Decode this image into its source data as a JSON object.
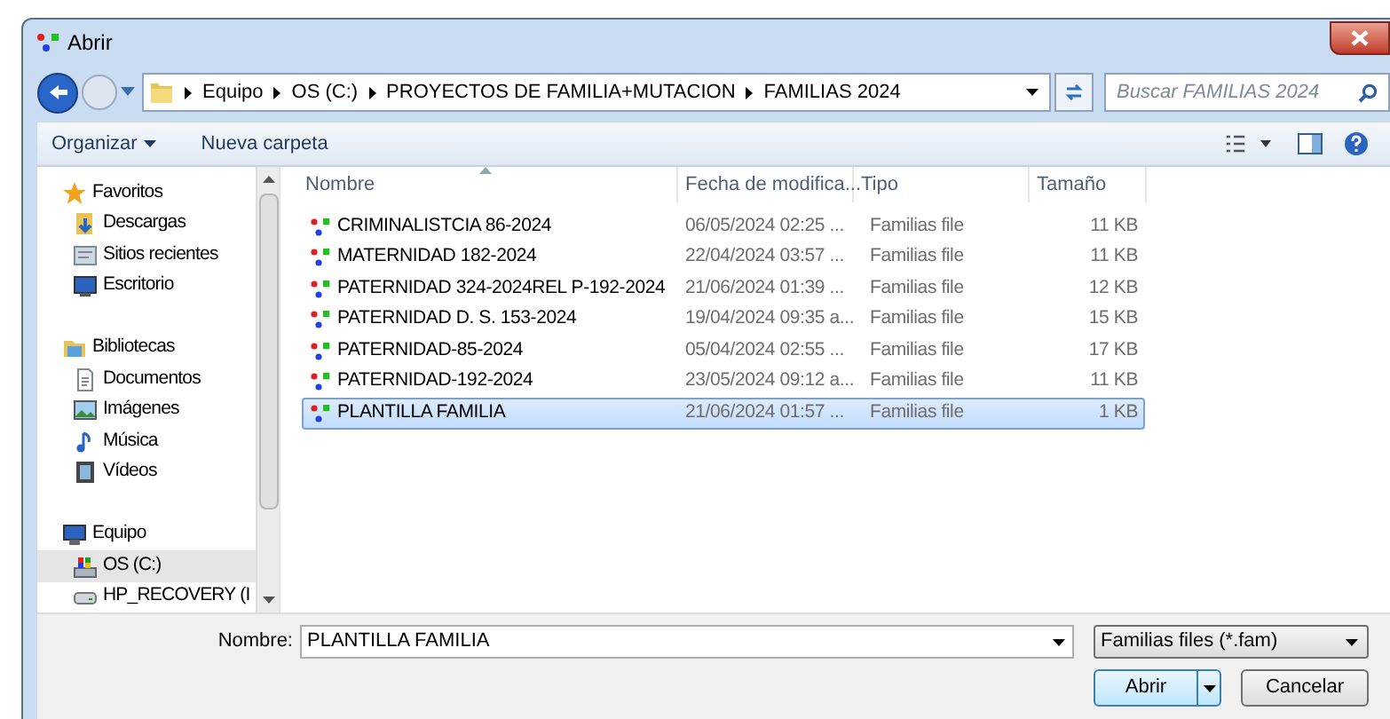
{
  "window": {
    "title": "Abrir"
  },
  "breadcrumb": [
    "Equipo",
    "OS (C:)",
    "PROYECTOS DE FAMILIA+MUTACION",
    "FAMILIAS 2024"
  ],
  "search": {
    "placeholder": "Buscar FAMILIAS 2024"
  },
  "toolbar": [
    "Organizar",
    "Nueva carpeta"
  ],
  "sidebar": [
    {
      "label": "Favoritos",
      "kind": "star",
      "selected": false,
      "children": [
        {
          "label": "Descargas",
          "kind": "download",
          "selected": false
        },
        {
          "label": "Sitios recientes",
          "kind": "recent",
          "selected": false
        },
        {
          "label": "Escritorio",
          "kind": "desktop",
          "selected": false
        }
      ]
    },
    {
      "label": "Bibliotecas",
      "kind": "library",
      "selected": false,
      "children": [
        {
          "label": "Documentos",
          "kind": "document",
          "selected": false
        },
        {
          "label": "Imágenes",
          "kind": "image",
          "selected": false
        },
        {
          "label": "Música",
          "kind": "music",
          "selected": false
        },
        {
          "label": "Vídeos",
          "kind": "video",
          "selected": false
        }
      ]
    },
    {
      "label": "Equipo",
      "kind": "computer",
      "selected": false,
      "children": [
        {
          "label": "OS (C:)",
          "kind": "drive",
          "selected": true
        },
        {
          "label": "HP_RECOVERY (I",
          "kind": "hdd",
          "selected": false
        }
      ]
    }
  ],
  "table": {
    "columns": [
      "Nombre",
      "Fecha de modifica...",
      "Tipo",
      "Tamaño"
    ],
    "rows": [
      {
        "name": "CRIMINALISTCIA 86-2024",
        "date": "06/05/2024 02:25 ...",
        "type": "Familias file",
        "size": "11 KB",
        "selected": false
      },
      {
        "name": "MATERNIDAD 182-2024",
        "date": "22/04/2024 03:57 ...",
        "type": "Familias file",
        "size": "11 KB",
        "selected": false
      },
      {
        "name": "PATERNIDAD 324-2024REL P-192-2024",
        "date": "21/06/2024 01:39 ...",
        "type": "Familias file",
        "size": "12 KB",
        "selected": false
      },
      {
        "name": "PATERNIDAD D. S. 153-2024",
        "date": "19/04/2024 09:35 a...",
        "type": "Familias file",
        "size": "15 KB",
        "selected": false
      },
      {
        "name": "PATERNIDAD-85-2024",
        "date": "05/04/2024 02:55 ...",
        "type": "Familias file",
        "size": "17 KB",
        "selected": false
      },
      {
        "name": "PATERNIDAD-192-2024",
        "date": "23/05/2024 09:12 a...",
        "type": "Familias file",
        "size": "11 KB",
        "selected": false
      },
      {
        "name": "PLANTILLA FAMILIA",
        "date": "21/06/2024 01:57 ...",
        "type": "Familias file",
        "size": "1 KB",
        "selected": true
      }
    ]
  },
  "filename": {
    "label": "Nombre:",
    "value": "PLANTILLA FAMILIA"
  },
  "filter": {
    "value": "Familias files (*.fam)"
  },
  "buttons": [
    {
      "label": "Abrir",
      "kind": "split"
    },
    {
      "label": "Cancelar",
      "kind": "plain"
    }
  ]
}
